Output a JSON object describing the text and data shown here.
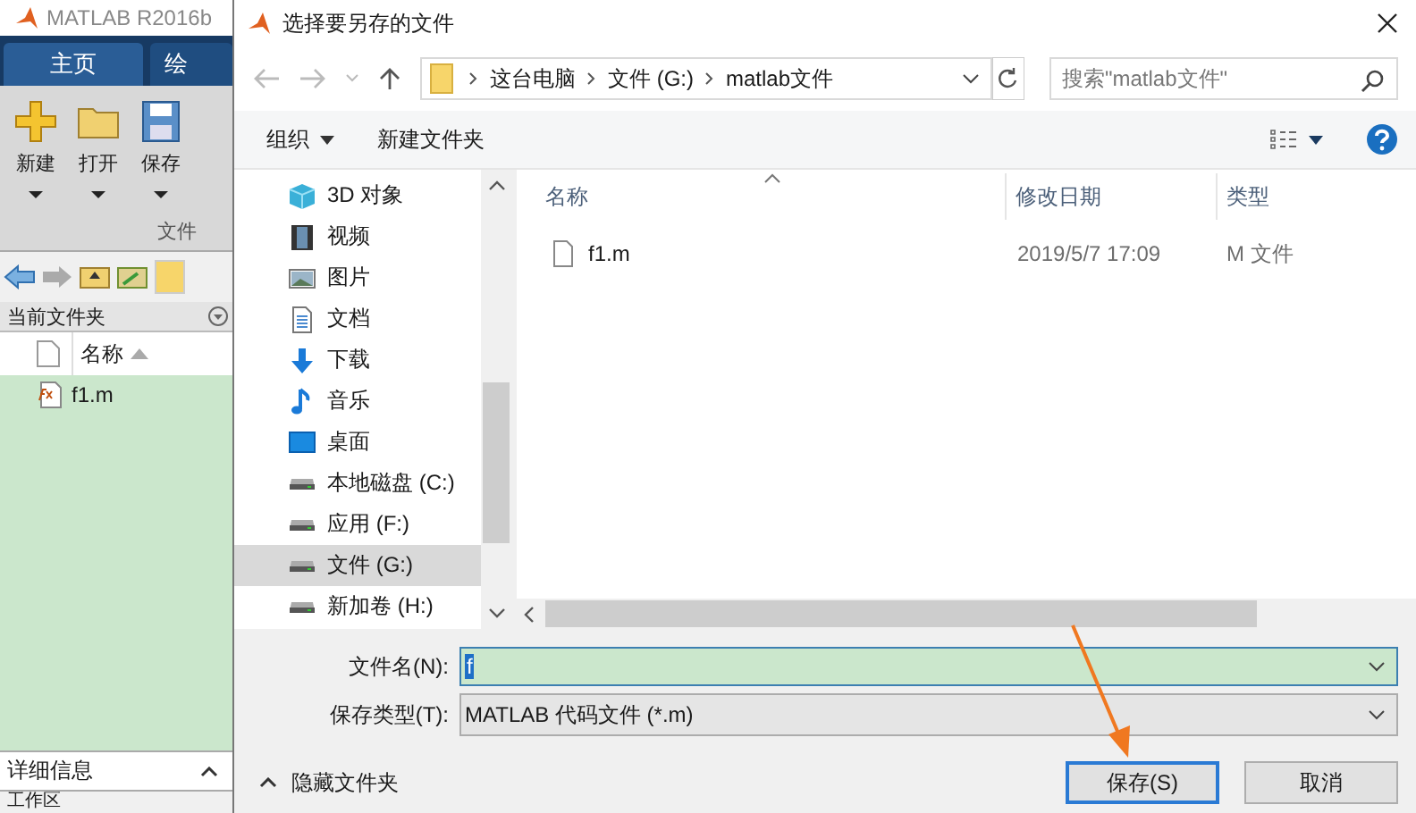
{
  "matlab": {
    "title": "MATLAB R2016b",
    "tabs": [
      {
        "label": "主页",
        "selected": true
      },
      {
        "label": "绘",
        "selected": false
      }
    ],
    "tools": [
      {
        "label": "新建",
        "kind": "new"
      },
      {
        "label": "打开",
        "kind": "open"
      },
      {
        "label": "保存",
        "kind": "save"
      }
    ],
    "section_label": "文件",
    "panel_title": "当前文件夹",
    "column": "名称",
    "files": [
      {
        "name": "f1.m",
        "selected": true
      }
    ],
    "details": "详细信息",
    "workspace": "工作区"
  },
  "dialog": {
    "title": "选择要另存的文件",
    "breadcrumbs": [
      "这台电脑",
      "文件 (G:)",
      "matlab文件"
    ],
    "search": {
      "placeholder": "搜索\"matlab文件\""
    },
    "commands": [
      "组织",
      "新建文件夹"
    ],
    "nav": [
      {
        "label": "3D 对象",
        "kind": "objects",
        "selected": false
      },
      {
        "label": "视频",
        "kind": "video",
        "selected": false
      },
      {
        "label": "图片",
        "kind": "pictures",
        "selected": false
      },
      {
        "label": "文档",
        "kind": "documents",
        "selected": false
      },
      {
        "label": "下载",
        "kind": "downloads",
        "selected": false
      },
      {
        "label": "音乐",
        "kind": "music",
        "selected": false
      },
      {
        "label": "桌面",
        "kind": "desktop",
        "selected": false
      },
      {
        "label": "本地磁盘 (C:)",
        "kind": "drive",
        "selected": false
      },
      {
        "label": "应用 (F:)",
        "kind": "drive",
        "selected": false
      },
      {
        "label": "文件 (G:)",
        "kind": "drive",
        "selected": true
      },
      {
        "label": "新加卷 (H:)",
        "kind": "drive",
        "selected": false
      }
    ],
    "columns": [
      "名称",
      "修改日期",
      "类型"
    ],
    "rows": [
      {
        "name": "f1.m",
        "date": "2019/5/7 17:09",
        "type": "M 文件"
      }
    ],
    "filename_label": "文件名(N):",
    "filename": {
      "value": "f"
    },
    "filetype_label": "保存类型(T):",
    "filetype": "MATLAB 代码文件 (*.m)",
    "hide_folders": "隐藏文件夹",
    "buttons": [
      {
        "label": "保存(S)",
        "default": true
      },
      {
        "label": "取消",
        "default": false
      }
    ]
  }
}
